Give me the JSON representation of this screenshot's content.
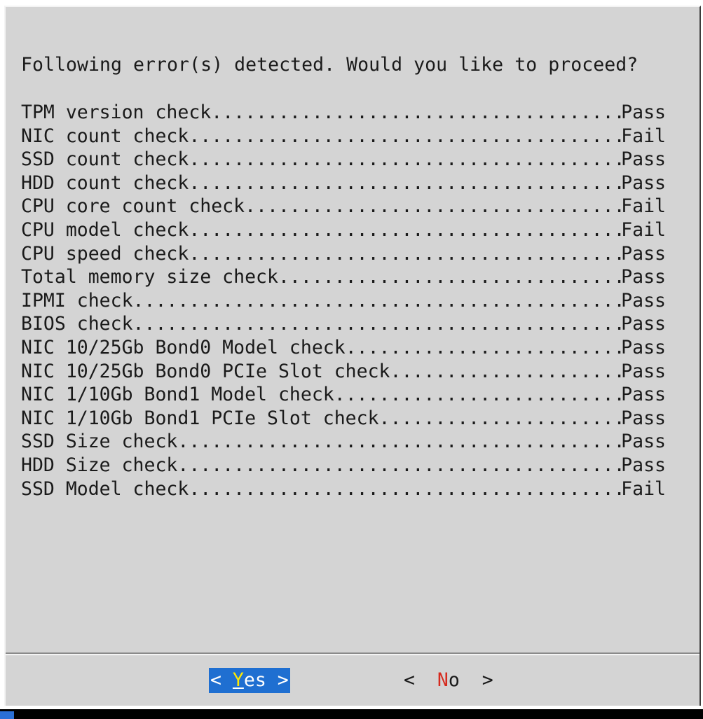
{
  "dialog": {
    "message": "Following error(s) detected. Would you like to proceed?",
    "checks": [
      {
        "name": "TPM version check",
        "result": "Pass"
      },
      {
        "name": "NIC count check",
        "result": "Fail"
      },
      {
        "name": "SSD count check",
        "result": "Pass"
      },
      {
        "name": "HDD count check",
        "result": "Pass"
      },
      {
        "name": "CPU core count check",
        "result": "Fail"
      },
      {
        "name": "CPU model check",
        "result": "Fail"
      },
      {
        "name": "CPU speed check",
        "result": "Pass"
      },
      {
        "name": "Total memory size check",
        "result": "Pass"
      },
      {
        "name": "IPMI check",
        "result": "Pass"
      },
      {
        "name": "BIOS check",
        "result": "Pass"
      },
      {
        "name": "NIC 10/25Gb Bond0 Model check",
        "result": "Pass"
      },
      {
        "name": "NIC 10/25Gb Bond0 PCIe Slot check",
        "result": "Pass"
      },
      {
        "name": "NIC 1/10Gb Bond1 Model check",
        "result": "Pass"
      },
      {
        "name": "NIC 1/10Gb Bond1 PCIe Slot check",
        "result": "Pass"
      },
      {
        "name": "SSD Size check",
        "result": "Pass"
      },
      {
        "name": "HDD Size check",
        "result": "Pass"
      },
      {
        "name": "SSD Model check",
        "result": "Fail"
      }
    ],
    "buttons": {
      "yes": {
        "open": "< ",
        "hotkey": "Y",
        "rest": "es",
        "close": " >"
      },
      "no": {
        "open": "<  ",
        "hotkey": "N",
        "rest": "o",
        "close": "  >"
      }
    }
  },
  "colors": {
    "dialog_background": "#d4d4d4",
    "selected_button": "#1f6fd1",
    "hotkey_selected": "#ffea00",
    "hotkey_unselected": "#d62a1e",
    "text": "#1a1a1a"
  }
}
